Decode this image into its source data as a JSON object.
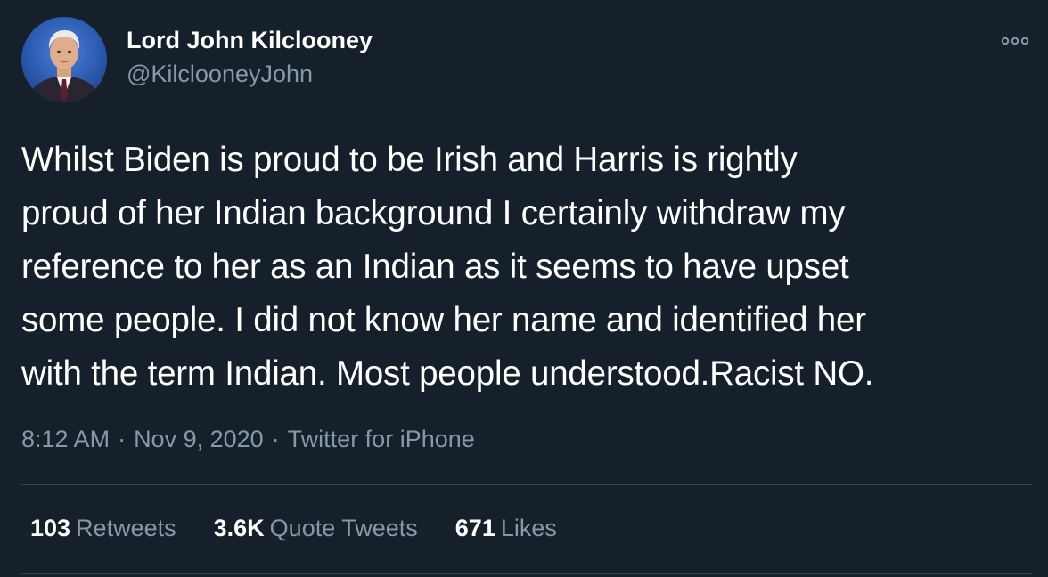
{
  "author": {
    "name": "Lord John Kilclooney",
    "handle": "@KilclooneyJohn",
    "avatar_icon": "profile-photo"
  },
  "more_icon": "more-options-icon",
  "tweet": {
    "lines": [
      "Whilst Biden is proud to be Irish and Harris is rightly",
      "proud of her Indian background I certainly withdraw my",
      "reference to her as an Indian as it seems to have upset",
      "some people. I did not know her name and identified her",
      "with the term Indian. Most people understood.Racist NO."
    ]
  },
  "meta": {
    "time": "8:12 AM",
    "separator": "·",
    "date": "Nov 9, 2020",
    "source": "Twitter for iPhone"
  },
  "stats": {
    "retweets": {
      "count": "103",
      "label": "Retweets"
    },
    "quotes": {
      "count": "3.6K",
      "label": "Quote Tweets"
    },
    "likes": {
      "count": "671",
      "label": "Likes"
    }
  },
  "colors": {
    "background": "#15202b",
    "primary_text": "#ffffff",
    "secondary_text": "#8899a6",
    "divider": "#38444d"
  }
}
